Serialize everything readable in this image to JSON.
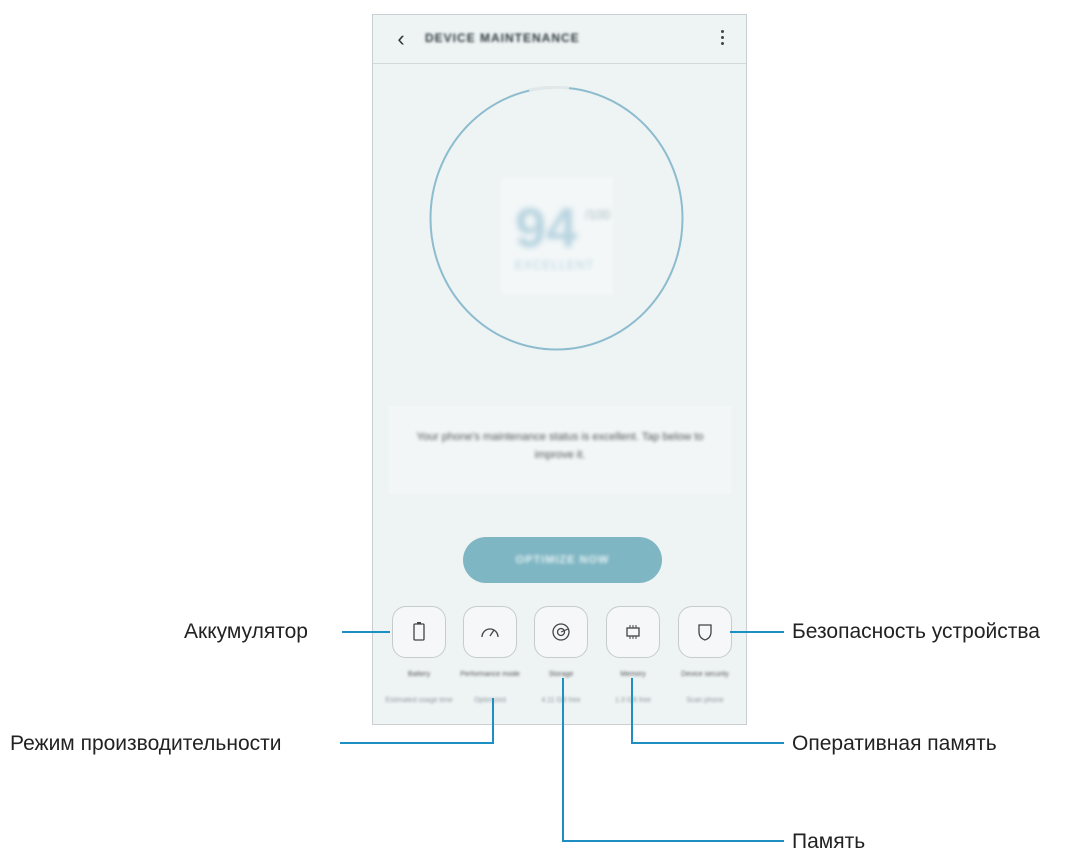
{
  "app_bar": {
    "back_icon": "chevron-left-icon",
    "title": "DEVICE MAINTENANCE",
    "more_icon": "more-vertical-icon"
  },
  "score": {
    "value": "94",
    "unit": "/100",
    "label": "EXCELLENT"
  },
  "status_message": "Your phone's maintenance status is excellent. Tap below to improve it.",
  "optimize_button": "OPTIMIZE NOW",
  "categories": [
    {
      "label": "Battery",
      "sub": "Estimated usage time",
      "icon": "battery-icon"
    },
    {
      "label": "Performance mode",
      "sub": "Optimized",
      "icon": "speedometer-icon"
    },
    {
      "label": "Storage",
      "sub": "4.11 GB free",
      "icon": "storage-icon"
    },
    {
      "label": "Memory",
      "sub": "1.3 GB free",
      "icon": "memory-chip-icon"
    },
    {
      "label": "Device security",
      "sub": "Scan phone",
      "icon": "shield-icon"
    }
  ],
  "callouts": {
    "battery": "Аккумулятор",
    "performance": "Режим производительности",
    "storage": "Память",
    "memory": "Оперативная память",
    "security": "Безопасность устройства"
  },
  "colors": {
    "accent": "#1d8fc2",
    "ring": "#8dbccf",
    "button": "#7fb6c3",
    "screen_bg": "#eef3f4"
  }
}
